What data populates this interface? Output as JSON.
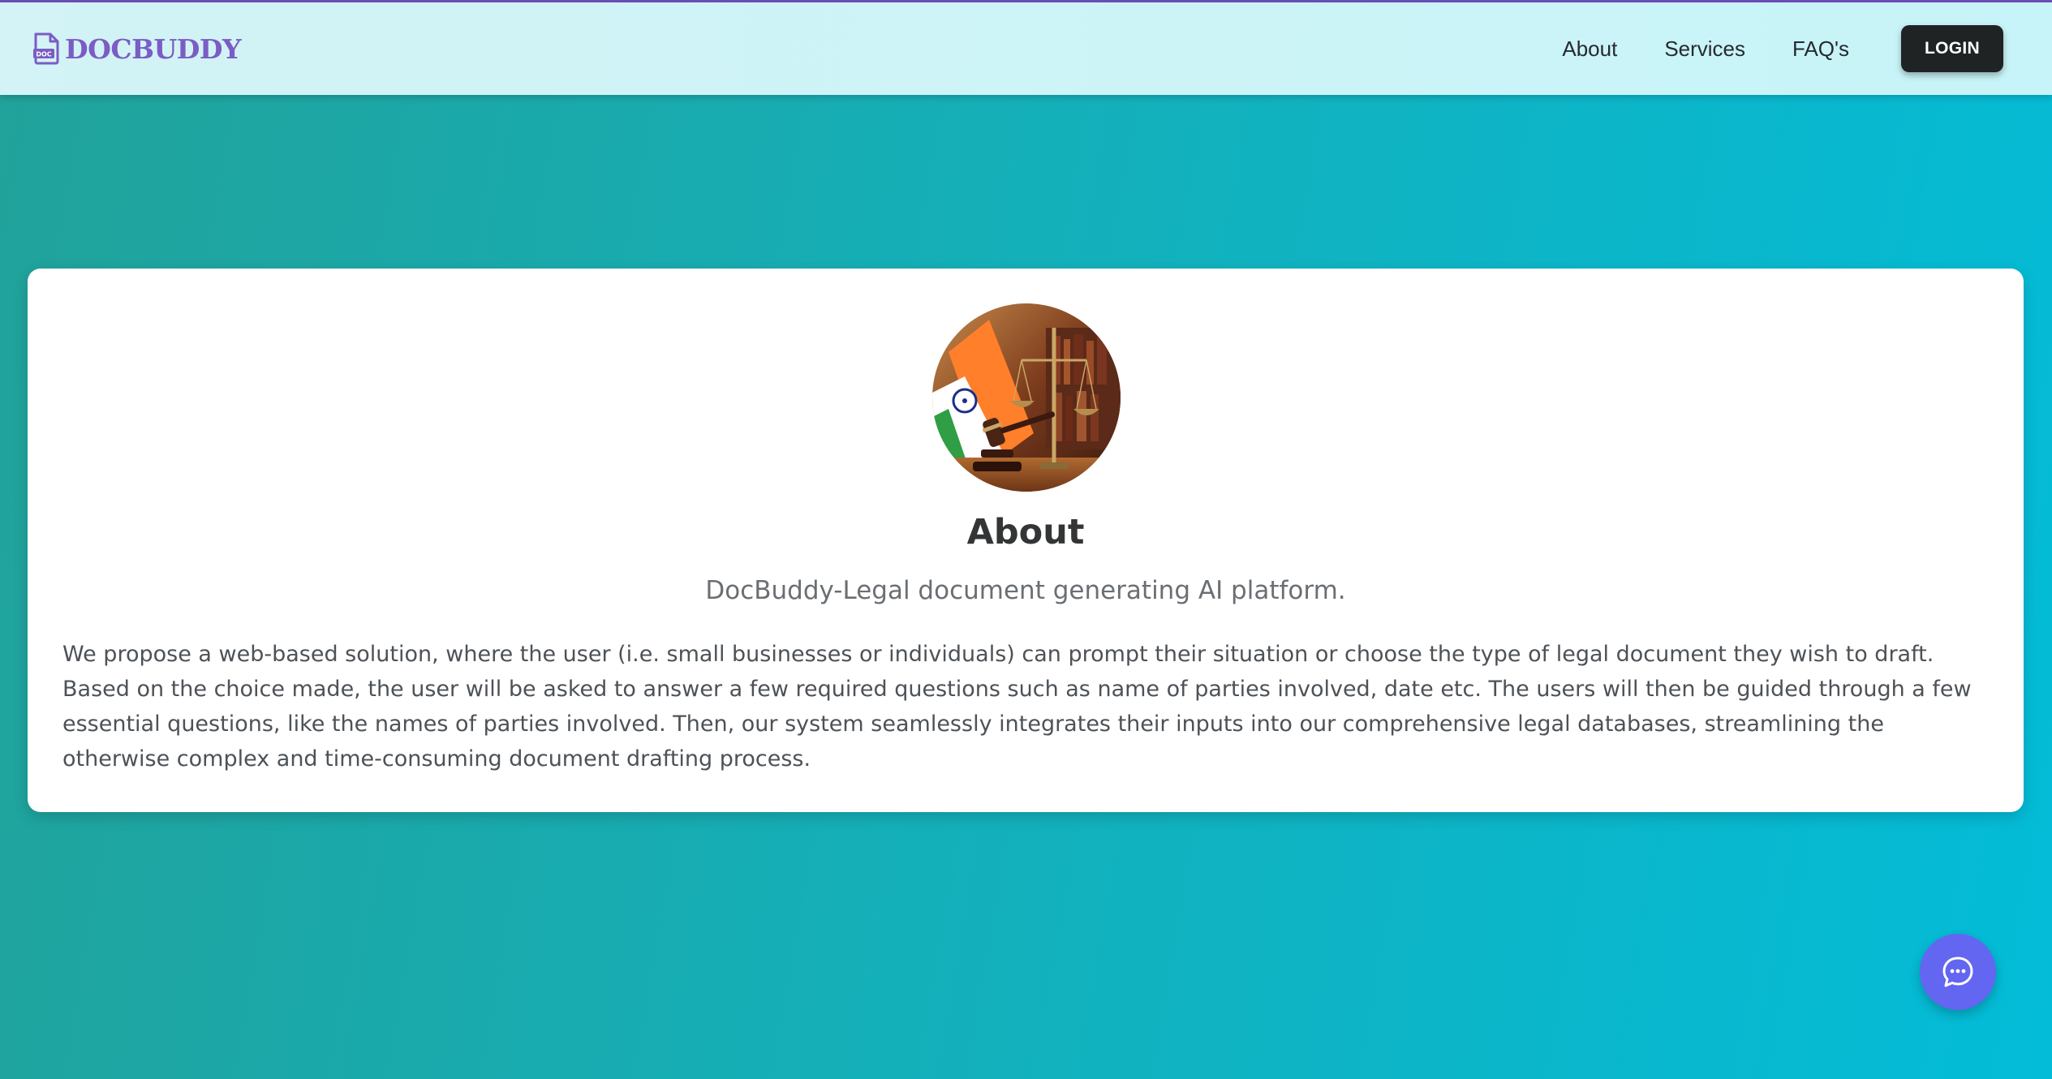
{
  "header": {
    "brand_name": "DOCBUDDY",
    "brand_icon_label": "DOC",
    "nav": [
      {
        "label": "About"
      },
      {
        "label": "Services"
      },
      {
        "label": "FAQ's"
      }
    ],
    "login_label": "LOGIN"
  },
  "about": {
    "title": "About",
    "subtitle": "DocBuddy-Legal document generating AI platform.",
    "description": "We propose a web-based solution, where the user (i.e. small businesses or individuals) can prompt their situation or choose the type of legal document they wish to draft. Based on the choice made, the user will be asked to answer a few required questions such as name of parties involved, date etc. The users will then be guided through a few essential questions, like the names of parties involved. Then, our system seamlessly integrates their inputs into our comprehensive legal databases, streamlining the otherwise complex and time-consuming document drafting process."
  },
  "icons": {
    "brand": "document-icon",
    "chat": "chat-bubble-icon"
  },
  "colors": {
    "brand": "#7b5cc4",
    "login_bg": "#202324",
    "chat_button": "#6366f1",
    "page_gradient_start": "#21a29a",
    "page_gradient_end": "#03bcd8"
  }
}
